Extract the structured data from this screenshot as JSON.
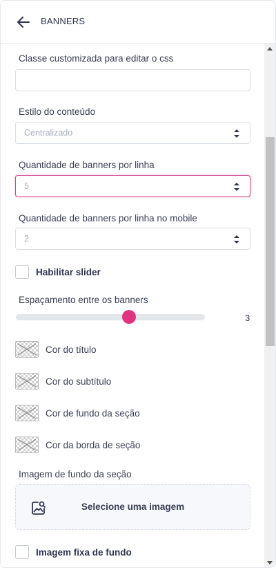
{
  "header": {
    "title": "BANNERS"
  },
  "fields": {
    "css_class": {
      "label": "Classe customizada para editar o css",
      "value": "",
      "placeholder": ""
    },
    "content_style": {
      "label": "Estilo do conteúdo",
      "value": "Centralizado"
    },
    "banners_per_row": {
      "label": "Quantidade de banners por linha",
      "value": "5"
    },
    "banners_per_row_mobile": {
      "label": "Quantidade de banners por linha no mobile",
      "value": "2"
    },
    "enable_slider": {
      "label": "Habilitar slider",
      "checked": false
    },
    "spacing": {
      "label": "Espaçamento entre os banners",
      "value": "3",
      "level": 0.6
    },
    "colors": [
      {
        "label": "Cor do título"
      },
      {
        "label": "Cor do subtítulo"
      },
      {
        "label": "Cor de fundo da seção"
      },
      {
        "label": "Cor da borda de seção"
      }
    ],
    "background_image": {
      "label": "Imagem de fundo da seção",
      "button_label": "Selecione uma imagem"
    },
    "fixed_background": {
      "label": "Imagem fixa de fundo",
      "checked": false
    }
  },
  "theme": {
    "accent": "#e0347e",
    "focus_border": "#d5418b",
    "text": "#2f3550"
  }
}
